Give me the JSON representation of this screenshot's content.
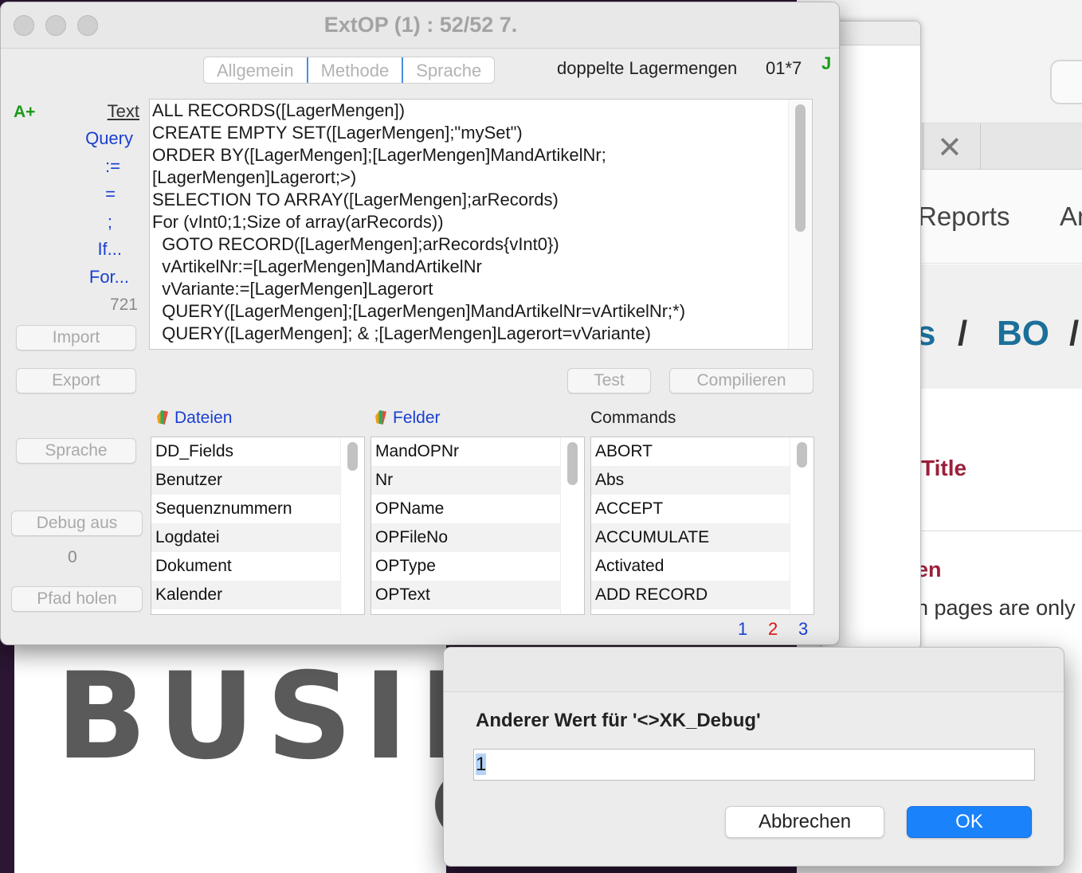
{
  "window": {
    "title": "ExtOP (1) : 52/52 7.",
    "tabs": [
      "Allgemein",
      "Methode",
      "Sprache"
    ],
    "header_label": "doppelte Lagermengen",
    "header_code": "01*7",
    "header_flag": "J"
  },
  "sidebar": {
    "badge": "A+",
    "text_link": "Text",
    "links": [
      "Query",
      ":=",
      "=",
      ";",
      "If...",
      "For..."
    ],
    "line_count": "721",
    "import_label": "Import",
    "export_label": "Export",
    "sprache_label": "Sprache",
    "debug_label": "Debug aus",
    "debug_value": "0",
    "pfad_label": "Pfad holen"
  },
  "code": {
    "lines": [
      "ALL RECORDS([LagerMengen])",
      "CREATE EMPTY SET([LagerMengen];\"mySet\")",
      "ORDER BY([LagerMengen];[LagerMengen]MandArtikelNr;",
      "[LagerMengen]Lagerort;>)",
      "SELECTION TO ARRAY([LagerMengen];arRecords)",
      "For (vInt0;1;Size of array(arRecords))",
      "  GOTO RECORD([LagerMengen];arRecords{vInt0})",
      "  vArtikelNr:=[LagerMengen]MandArtikelNr",
      "  vVariante:=[LagerMengen]Lagerort",
      "  QUERY([LagerMengen];[LagerMengen]MandArtikelNr=vArtikelNr;*)",
      "  QUERY([LagerMengen]; & ;[LagerMengen]Lagerort=vVariante)"
    ]
  },
  "actions": {
    "test_label": "Test",
    "compile_label": "Compilieren"
  },
  "lists": {
    "dateien": {
      "header": "Dateien",
      "items": [
        "DD_Fields",
        "Benutzer",
        "Sequenznummern",
        "Logdatei",
        "Dokument",
        "Kalender"
      ]
    },
    "felder": {
      "header": "Felder",
      "items": [
        "MandOPNr",
        "Nr",
        "OPName",
        "OPFileNo",
        "OPType",
        "OPText"
      ]
    },
    "commands": {
      "header": "Commands",
      "items": [
        "ABORT",
        "Abs",
        "ACCEPT",
        "ACCUMULATE",
        "Activated",
        "ADD RECORD"
      ]
    }
  },
  "pager": [
    "1",
    "2",
    "3"
  ],
  "dialog": {
    "prompt": "Anderer Wert für '<>XK_Debug'",
    "value": "1",
    "cancel_label": "Abbrechen",
    "ok_label": "OK"
  },
  "background": {
    "nav_reports": "Reports",
    "nav_partial": "Ar",
    "crumb_partial": "s",
    "crumb_sep": "/",
    "crumb_bo": "BO",
    "title_partial": "Title",
    "heading_partial": "en",
    "text_partial": "n pages are only",
    "logo_text": "BUSIN"
  },
  "colors": {
    "link_blue": "#1a3fd1",
    "green": "#1a9a1a",
    "pager_red": "#e01010",
    "accent": "#1a82fb"
  }
}
